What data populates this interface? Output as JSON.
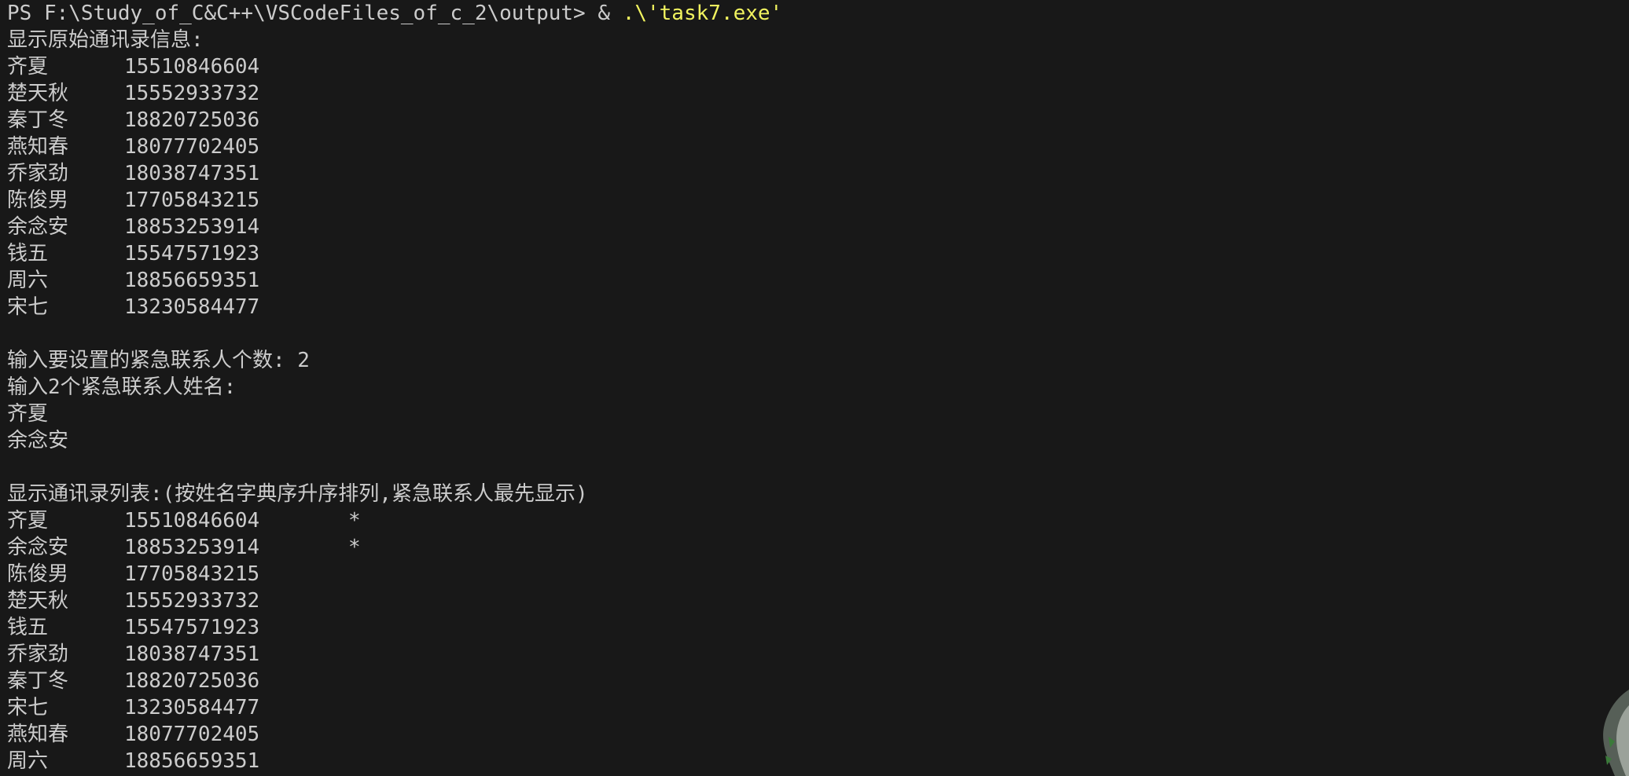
{
  "prompt": {
    "ps_path": "PS F:\\Study_of_C&C++\\VSCodeFiles_of_c_2\\output>",
    "operator": "&",
    "command": ".\\'task7.exe'"
  },
  "original_heading": "显示原始通讯录信息:",
  "original_contacts": [
    {
      "name": "齐夏",
      "phone": "15510846604"
    },
    {
      "name": "楚天秋",
      "phone": "15552933732"
    },
    {
      "name": "秦丁冬",
      "phone": "18820725036"
    },
    {
      "name": "燕知春",
      "phone": "18077702405"
    },
    {
      "name": "乔家劲",
      "phone": "18038747351"
    },
    {
      "name": "陈俊男",
      "phone": "17705843215"
    },
    {
      "name": "余念安",
      "phone": "18853253914"
    },
    {
      "name": "钱五",
      "phone": "15547571923"
    },
    {
      "name": "周六",
      "phone": "18856659351"
    },
    {
      "name": "宋七",
      "phone": "13230584477"
    }
  ],
  "emergency_count_prompt": "输入要设置的紧急联系人个数: 2",
  "emergency_names_prompt": "输入2个紧急联系人姓名:",
  "emergency_inputs": [
    "齐夏",
    "余念安"
  ],
  "sorted_heading": "显示通讯录列表:(按姓名字典序升序排列,紧急联系人最先显示)",
  "sorted_contacts": [
    {
      "name": "齐夏",
      "phone": "15510846604",
      "mark": "*"
    },
    {
      "name": "余念安",
      "phone": "18853253914",
      "mark": "*"
    },
    {
      "name": "陈俊男",
      "phone": "17705843215",
      "mark": ""
    },
    {
      "name": "楚天秋",
      "phone": "15552933732",
      "mark": ""
    },
    {
      "name": "钱五",
      "phone": "15547571923",
      "mark": ""
    },
    {
      "name": "乔家劲",
      "phone": "18038747351",
      "mark": ""
    },
    {
      "name": "秦丁冬",
      "phone": "18820725036",
      "mark": ""
    },
    {
      "name": "宋七",
      "phone": "13230584477",
      "mark": ""
    },
    {
      "name": "燕知春",
      "phone": "18077702405",
      "mark": ""
    },
    {
      "name": "周六",
      "phone": "18856659351",
      "mark": ""
    }
  ],
  "colors": {
    "background": "#181818",
    "text": "#cccccc",
    "command_highlight": "#f1f35f"
  }
}
